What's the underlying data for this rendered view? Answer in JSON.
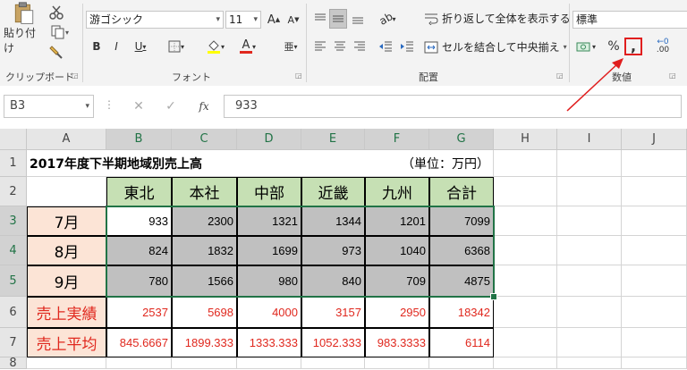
{
  "ribbon": {
    "clipboard": {
      "paste_label": "貼り付け",
      "group_label": "クリップボード"
    },
    "font": {
      "font_name": "游ゴシック",
      "font_size": "11",
      "bold": "B",
      "italic": "I",
      "underline": "U",
      "grow": "A",
      "shrink": "A",
      "font_color_glyph": "A",
      "group_label": "フォント"
    },
    "alignment": {
      "wrap_text": "折り返して全体を表示する",
      "merge_center": "セルを結合して中央揃え",
      "group_label": "配置"
    },
    "number": {
      "format": "標準",
      "percent": "%",
      "comma": ",",
      "inc_decimal": ".00",
      "group_label": "数値"
    }
  },
  "formula_bar": {
    "name_box": "B3",
    "fx": "fx",
    "value": "933"
  },
  "grid": {
    "columns": [
      "A",
      "B",
      "C",
      "D",
      "E",
      "F",
      "G",
      "H",
      "I",
      "J"
    ],
    "rows": [
      "1",
      "2",
      "3",
      "4",
      "5",
      "6",
      "7",
      "8"
    ],
    "title": "2017年度下半期地域別売上高",
    "unit": "（単位：万円）",
    "headers": [
      "東北",
      "本社",
      "中部",
      "近畿",
      "九州",
      "合計"
    ],
    "months": [
      "7月",
      "8月",
      "9月"
    ],
    "data": [
      [
        "933",
        "2300",
        "1321",
        "1344",
        "1201",
        "7099"
      ],
      [
        "824",
        "1832",
        "1699",
        "973",
        "1040",
        "6368"
      ],
      [
        "780",
        "1566",
        "980",
        "840",
        "709",
        "4875"
      ]
    ],
    "total_label": "売上実績",
    "totals": [
      "2537",
      "5698",
      "4000",
      "3157",
      "2950",
      "18342"
    ],
    "avg_label": "売上平均",
    "averages": [
      "845.6667",
      "1899.333",
      "1333.333",
      "1052.333",
      "983.3333",
      "6114"
    ]
  },
  "colors": {
    "accent": "#217346",
    "header_green": "#c6e0b4",
    "month_peach": "#fce4d6",
    "red_text": "#e0281e",
    "arrow": "#e01e1e"
  }
}
